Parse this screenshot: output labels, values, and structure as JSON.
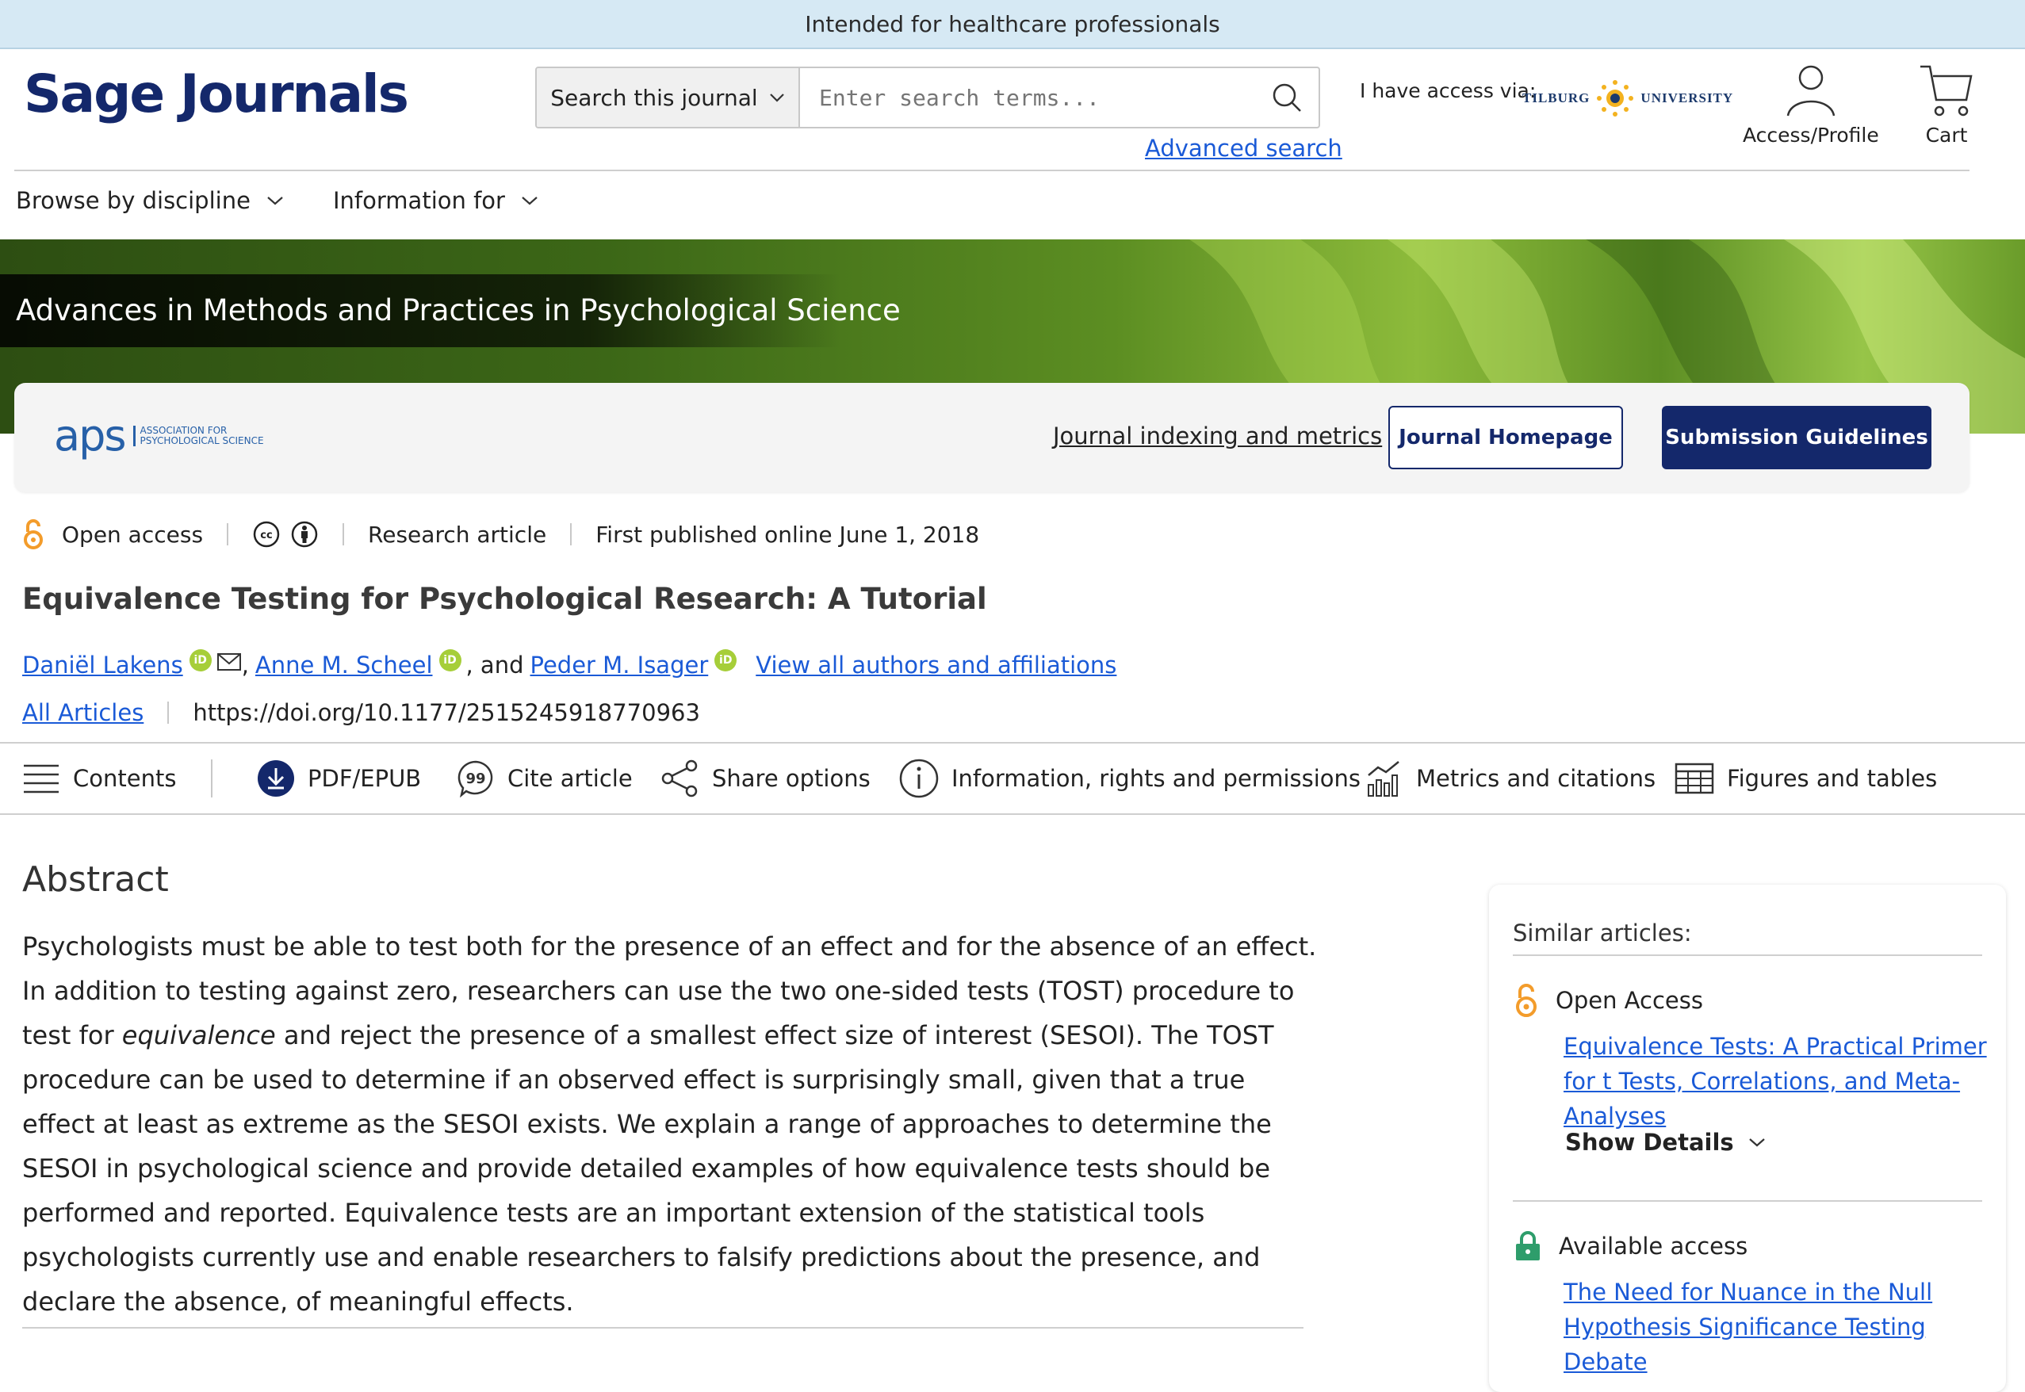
{
  "banner": {
    "text": "Intended for healthcare professionals"
  },
  "header": {
    "logo_text": "Sage Journals",
    "search_scope": "Search this journal",
    "search_placeholder": "Enter search terms...",
    "advanced_search": "Advanced search",
    "access_via": "I have access via:",
    "institution_left": "Tilburg",
    "institution_right": "University",
    "access_profile": "Access/Profile",
    "cart": "Cart"
  },
  "nav": {
    "browse": "Browse by discipline",
    "info": "Information for"
  },
  "journal": {
    "name": "Advances in Methods and Practices in Psychological Science",
    "logo_text": "aps",
    "logo_sub_1": "ASSOCIATION FOR",
    "logo_sub_2": "PSYCHOLOGICAL SCIENCE",
    "indexing_link": "Journal indexing and metrics",
    "homepage_button": "Journal Homepage",
    "submission_button": "Submission Guidelines"
  },
  "article": {
    "access": "Open access",
    "type": "Research article",
    "published": "First published online June 1, 2018",
    "title": "Equivalence Testing for Psychological Research: A Tutorial",
    "authors": [
      "Daniël Lakens",
      "Anne M. Scheel",
      "Peder M. Isager"
    ],
    "author_sep_1": ",",
    "author_sep_2": ", and",
    "view_all": "View all authors and affiliations",
    "all_articles": "All Articles",
    "doi": "https://doi.org/10.1177/2515245918770963"
  },
  "toolbar": {
    "contents": "Contents",
    "pdf": "PDF/EPUB",
    "cite": "Cite article",
    "share": "Share options",
    "info": "Information, rights and permissions",
    "metrics": "Metrics and citations",
    "figures": "Figures and tables"
  },
  "abstract": {
    "heading": "Abstract",
    "part1": "Psychologists must be able to test both for the presence of an effect and for the absence of an effect. In addition to testing against zero, researchers can use the two one-sided tests (TOST) procedure to test for ",
    "emph": "equivalence",
    "part2": " and reject the presence of a smallest effect size of interest (SESOI). The TOST procedure can be used to determine if an observed effect is surprisingly small, given that a true effect at least as extreme as the SESOI exists. We explain a range of approaches to determine the SESOI in psychological science and provide detailed examples of how equivalence tests should be performed and reported. Equivalence tests are an important extension of the statistical tools psychologists currently use and enable researchers to falsify predictions about the presence, and declare the absence, of meaningful effects."
  },
  "similar": {
    "heading": "Similar articles:",
    "items": [
      {
        "access": "Open Access",
        "title": "Equivalence Tests: A Practical Primer for t Tests, Correlations, and Meta-Analyses",
        "show_details": "Show Details"
      },
      {
        "access": "Available access",
        "title": "The Need for Nuance in the Null Hypothesis Significance Testing Debate"
      }
    ]
  },
  "colors": {
    "brand": "#14286b",
    "link": "#1a5ad7",
    "open_access": "#f39c2b",
    "available_access": "#2e9d6b",
    "orcid": "#a6ce39"
  }
}
